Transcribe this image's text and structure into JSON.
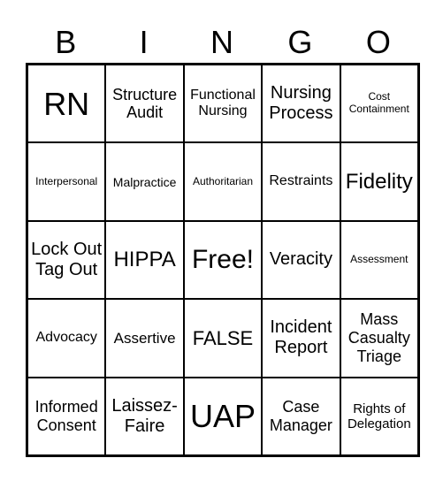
{
  "header": [
    "B",
    "I",
    "N",
    "G",
    "O"
  ],
  "cells": [
    "RN",
    "Structure Audit",
    "Functional Nursing",
    "Nursing Process",
    "Cost Containment",
    "Interpersonal",
    "Malpractice",
    "Authoritarian",
    "Restraints",
    "Fidelity",
    "Lock Out Tag Out",
    "HIPPA",
    "Free!",
    "Veracity",
    "Assessment",
    "Advocacy",
    "Assertive",
    "FALSE",
    "Incident Report",
    "Mass Casualty Triage",
    "Informed Consent",
    "Laissez-Faire",
    "UAP",
    "Case Manager",
    "Rights of Delegation"
  ]
}
